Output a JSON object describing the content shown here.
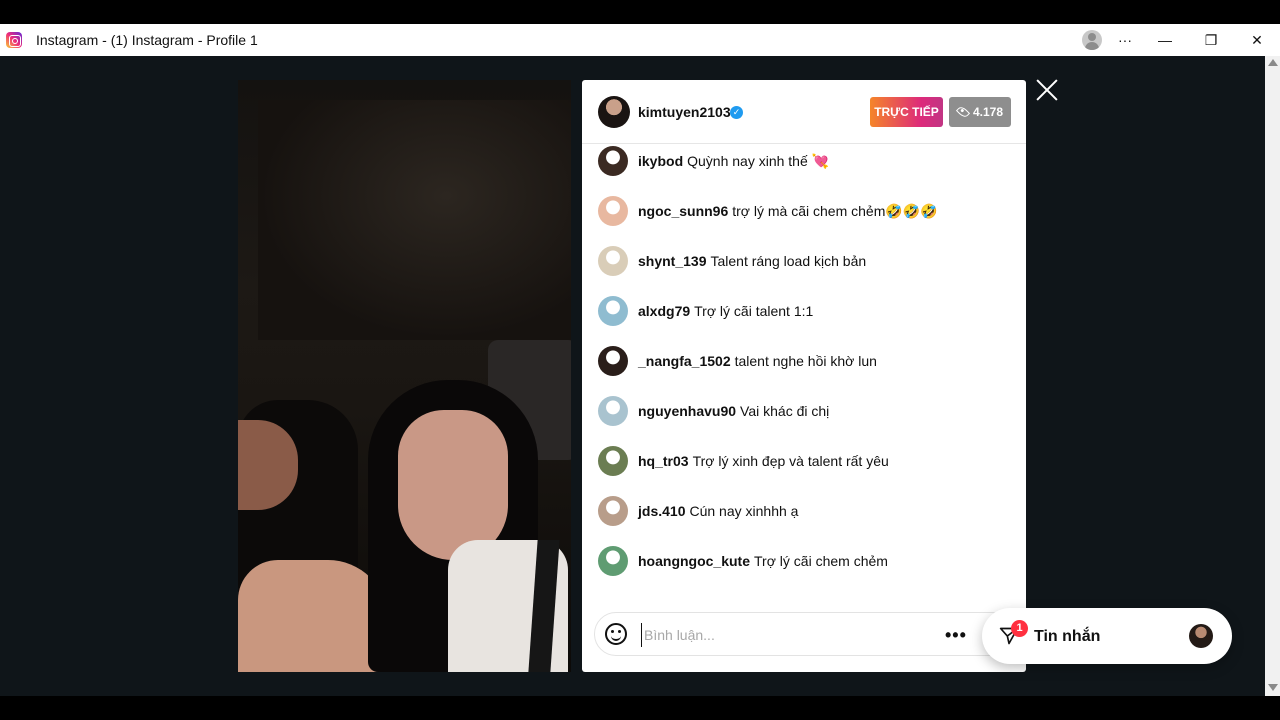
{
  "window": {
    "title": "Instagram - (1) Instagram - Profile 1",
    "more_label": "···",
    "minimize_label": "—",
    "restore_label": "❐",
    "close_label": "✕"
  },
  "live": {
    "host_username": "kimtuyen2103",
    "verified_mark": "✓",
    "live_badge": "TRỰC TIẾP",
    "viewer_count": "4.178"
  },
  "comments": [
    {
      "user": "ikybod",
      "text": "Quỳnh nay xinh thế 💘",
      "avatar_color": "#3b2a22"
    },
    {
      "user": "ngoc_sunn96",
      "text": "trợ lý mà cãi chem chẻm🤣🤣🤣",
      "avatar_color": "#e8b8a0"
    },
    {
      "user": "shynt_139",
      "text": "Talent ráng load kịch bản",
      "avatar_color": "#d9cdb8"
    },
    {
      "user": "alxdg79",
      "text": "Trợ lý cãi talent 1:1",
      "avatar_color": "#8fbcd0"
    },
    {
      "user": "_nangfa_1502",
      "text": "talent nghe hồi khờ lun",
      "avatar_color": "#2a1e1a"
    },
    {
      "user": "nguyenhavu90",
      "text": "Vai khác đi chị",
      "avatar_color": "#a9c3cf"
    },
    {
      "user": "hq_tr03",
      "text": "Trợ lý xinh đẹp và talent rất yêu",
      "avatar_color": "#6b7d52"
    },
    {
      "user": "jds.410",
      "text": "Cún nay xinhhh ạ",
      "avatar_color": "#b89d8a"
    },
    {
      "user": "hoangngoc_kute",
      "text": "Trợ lý cãi chem chẻm",
      "avatar_color": "#5f9c72"
    }
  ],
  "comment_input": {
    "placeholder": "Bình luận...",
    "more_label": "•••"
  },
  "messages": {
    "label": "Tin nhắn",
    "badge": "1"
  },
  "colors": {
    "accent_live": "#dd2a7b",
    "badge_red": "#ff3040",
    "verified_blue": "#1f9bf0"
  }
}
